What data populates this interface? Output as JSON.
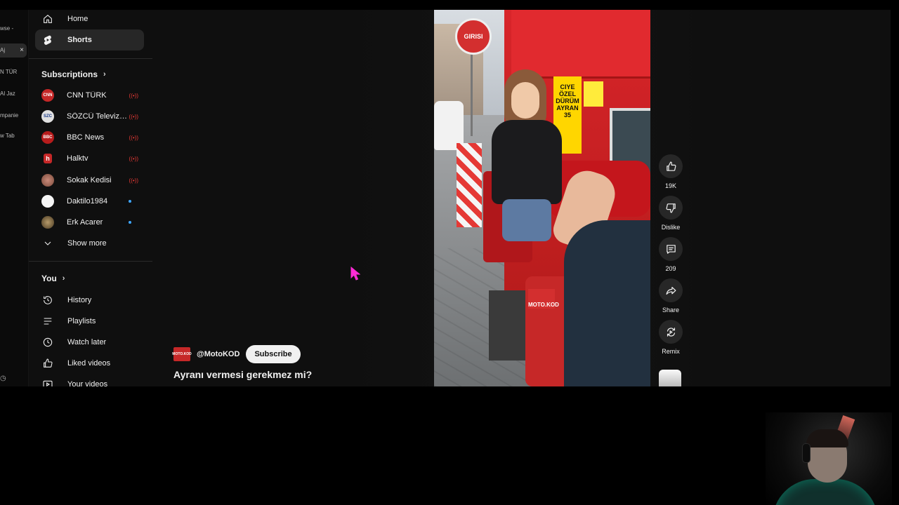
{
  "browser_strip": {
    "items": [
      "wse - ",
      "Aj",
      "N TÜR",
      "Al Jaz",
      "mpanie",
      "w Tab"
    ],
    "close_glyph": "×",
    "clock_glyph": "◷"
  },
  "sidebar": {
    "nav": [
      {
        "label": "Home",
        "icon": "home-icon"
      },
      {
        "label": "Shorts",
        "icon": "shorts-icon",
        "active": true
      }
    ],
    "subscriptions_title": "Subscriptions",
    "subscriptions": [
      {
        "label": "CNN TÜRK",
        "indicator": "live",
        "avatar_color": "#c62828",
        "avatar_text": "CNN"
      },
      {
        "label": "SÖZCÜ Televizyo...",
        "indicator": "live",
        "avatar_color": "#e0e0e0",
        "avatar_text": "SZC"
      },
      {
        "label": "BBC News",
        "indicator": "live",
        "avatar_color": "#b71c1c",
        "avatar_text": "BBC"
      },
      {
        "label": "Halktv",
        "indicator": "live",
        "avatar_color": "#c62828",
        "avatar_text": "h"
      },
      {
        "label": "Sokak Kedisi",
        "indicator": "live",
        "avatar_color": "#d7a9a0",
        "avatar_text": ""
      },
      {
        "label": "Daktilo1984",
        "indicator": "dot",
        "avatar_color": "#f5f5f5",
        "avatar_text": ""
      },
      {
        "label": "Erk Acarer",
        "indicator": "dot",
        "avatar_color": "#6d5a3a",
        "avatar_text": ""
      }
    ],
    "show_more": "Show more",
    "you_title": "You",
    "you_items": [
      {
        "label": "History",
        "icon": "history-icon"
      },
      {
        "label": "Playlists",
        "icon": "playlists-icon"
      },
      {
        "label": "Watch later",
        "icon": "watch-later-icon"
      },
      {
        "label": "Liked videos",
        "icon": "liked-videos-icon"
      },
      {
        "label": "Your videos",
        "icon": "your-videos-icon"
      }
    ],
    "live_glyph": "((•))"
  },
  "video": {
    "sign_text": "GIRISI",
    "poster_text": "CIYE ÖZEL DÜRÜM AYRAN 35",
    "logo_text": "MOTO.KOD",
    "channel_handle": "@MotoKOD",
    "channel_avatar_text": "MOTO.KOD",
    "subscribe_label": "Subscribe",
    "title": "Ayranı vermesi gerekmez mi?"
  },
  "actions": {
    "like_count": "19K",
    "dislike_label": "Dislike",
    "comment_count": "209",
    "share_label": "Share",
    "remix_label": "Remix"
  },
  "colors": {
    "background": "#0f0f0f",
    "active_item": "#272727",
    "live_red": "#e53935",
    "new_dot": "#3ea6ff",
    "cursor": "#ff2bd6"
  }
}
